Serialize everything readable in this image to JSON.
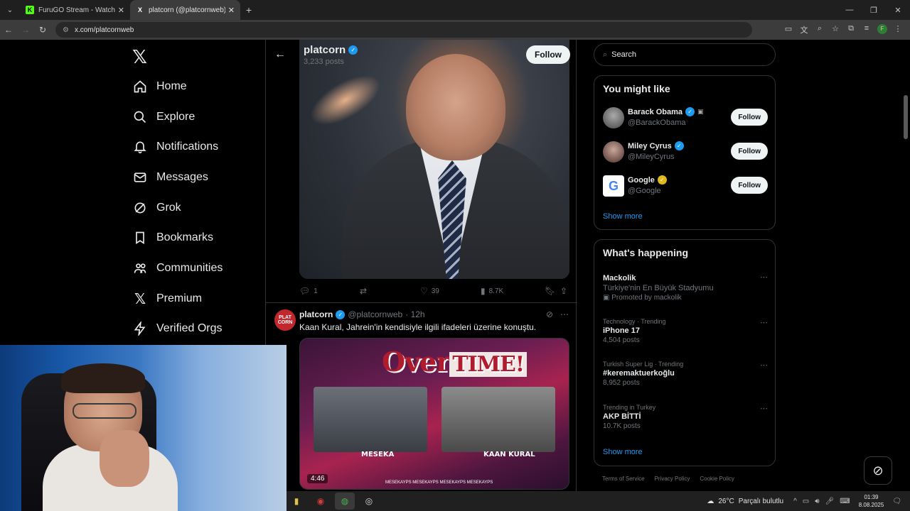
{
  "browser": {
    "tabs": [
      {
        "title": "FuruGO Stream - Watch Live on",
        "favicon": "K",
        "active": false
      },
      {
        "title": "platcorn (@platcornweb) / X",
        "favicon": "X",
        "active": true
      }
    ],
    "url": "x.com/platcornweb"
  },
  "nav": {
    "items": [
      {
        "label": "Home",
        "icon": "home-icon"
      },
      {
        "label": "Explore",
        "icon": "search-icon"
      },
      {
        "label": "Notifications",
        "icon": "bell-icon"
      },
      {
        "label": "Messages",
        "icon": "mail-icon"
      },
      {
        "label": "Grok",
        "icon": "grok-icon"
      },
      {
        "label": "Bookmarks",
        "icon": "bookmark-icon"
      },
      {
        "label": "Communities",
        "icon": "people-icon"
      },
      {
        "label": "Premium",
        "icon": "x-icon"
      },
      {
        "label": "Verified Orgs",
        "icon": "bolt-icon"
      }
    ]
  },
  "profile": {
    "name": "platcorn",
    "posts": "3,233 posts",
    "follow_label": "Follow"
  },
  "tweet1": {
    "replies": "1",
    "likes": "39",
    "views": "8.7K"
  },
  "tweet2": {
    "name": "platcorn",
    "handle": "@platcornweb",
    "time": "· 12h",
    "text": "Kaan Kural, Jahrein'in kendisiyle ilgili ifadeleri üzerine konuştu.",
    "avatar_text": "PLAT CORN",
    "media": {
      "title_part1": "Over",
      "title_part2": "TIME!",
      "left_name": "MESEKA",
      "right_name": "KAAN KURAL",
      "duration": "4:46",
      "socials": "MESEKAYPS  MESEKAYPS  MESEKAYPS  MESEKAYPS"
    }
  },
  "search": {
    "placeholder": "Search"
  },
  "you_might_like": {
    "title": "You might like",
    "users": [
      {
        "name": "Barack Obama",
        "handle": "@BarackObama",
        "badge": "blue",
        "follow": "Follow"
      },
      {
        "name": "Miley Cyrus",
        "handle": "@MileyCyrus",
        "badge": "blue",
        "follow": "Follow"
      },
      {
        "name": "Google",
        "handle": "@Google",
        "badge": "gold",
        "follow": "Follow"
      }
    ],
    "show_more": "Show more"
  },
  "happening": {
    "title": "What's happening",
    "items": [
      {
        "meta": "",
        "title": "Mackolik",
        "sub": "Türkiye'nin En Büyük Stadyumu",
        "count": "Promoted by mackolik"
      },
      {
        "meta": "Technology · Trending",
        "title": "iPhone 17",
        "sub": "",
        "count": "4,504 posts"
      },
      {
        "meta": "Turkish Super Lig · Trending",
        "title": "#keremaktuerkoğlu",
        "sub": "",
        "count": "8,952 posts"
      },
      {
        "meta": "Trending in Turkey",
        "title": "AKP BİTTİ",
        "sub": "",
        "count": "10.7K posts"
      }
    ],
    "show_more": "Show more"
  },
  "footer": [
    "Terms of Service",
    "Privacy Policy",
    "Cookie Policy"
  ],
  "taskbar": {
    "weather_temp": "26°C",
    "weather_text": "Parçalı bulutlu",
    "time": "01:39",
    "date": "8.08.2025"
  },
  "colors": {
    "accent": "#1d9bf0",
    "gold": "#e2b719",
    "bg": "#000000"
  }
}
